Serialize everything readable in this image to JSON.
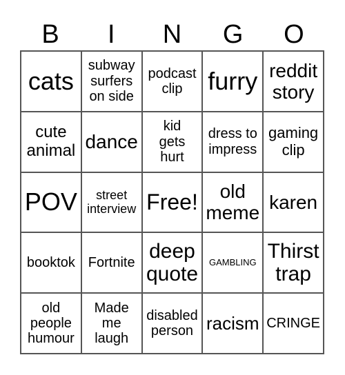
{
  "header": [
    "B",
    "I",
    "N",
    "G",
    "O"
  ],
  "cells": [
    "cats",
    "subway surfers on side",
    "podcast clip",
    "furry",
    "reddit story",
    "cute animal",
    "dance",
    "kid gets hurt",
    "dress to impress",
    "gaming clip",
    "POV",
    "street interview",
    "Free!",
    "old meme",
    "karen",
    "booktok",
    "Fortnite",
    "deep quote",
    "GAMBLING",
    "Thirst trap",
    "old people humour",
    "Made me laugh",
    "disabled person",
    "racism",
    "CRINGE"
  ]
}
